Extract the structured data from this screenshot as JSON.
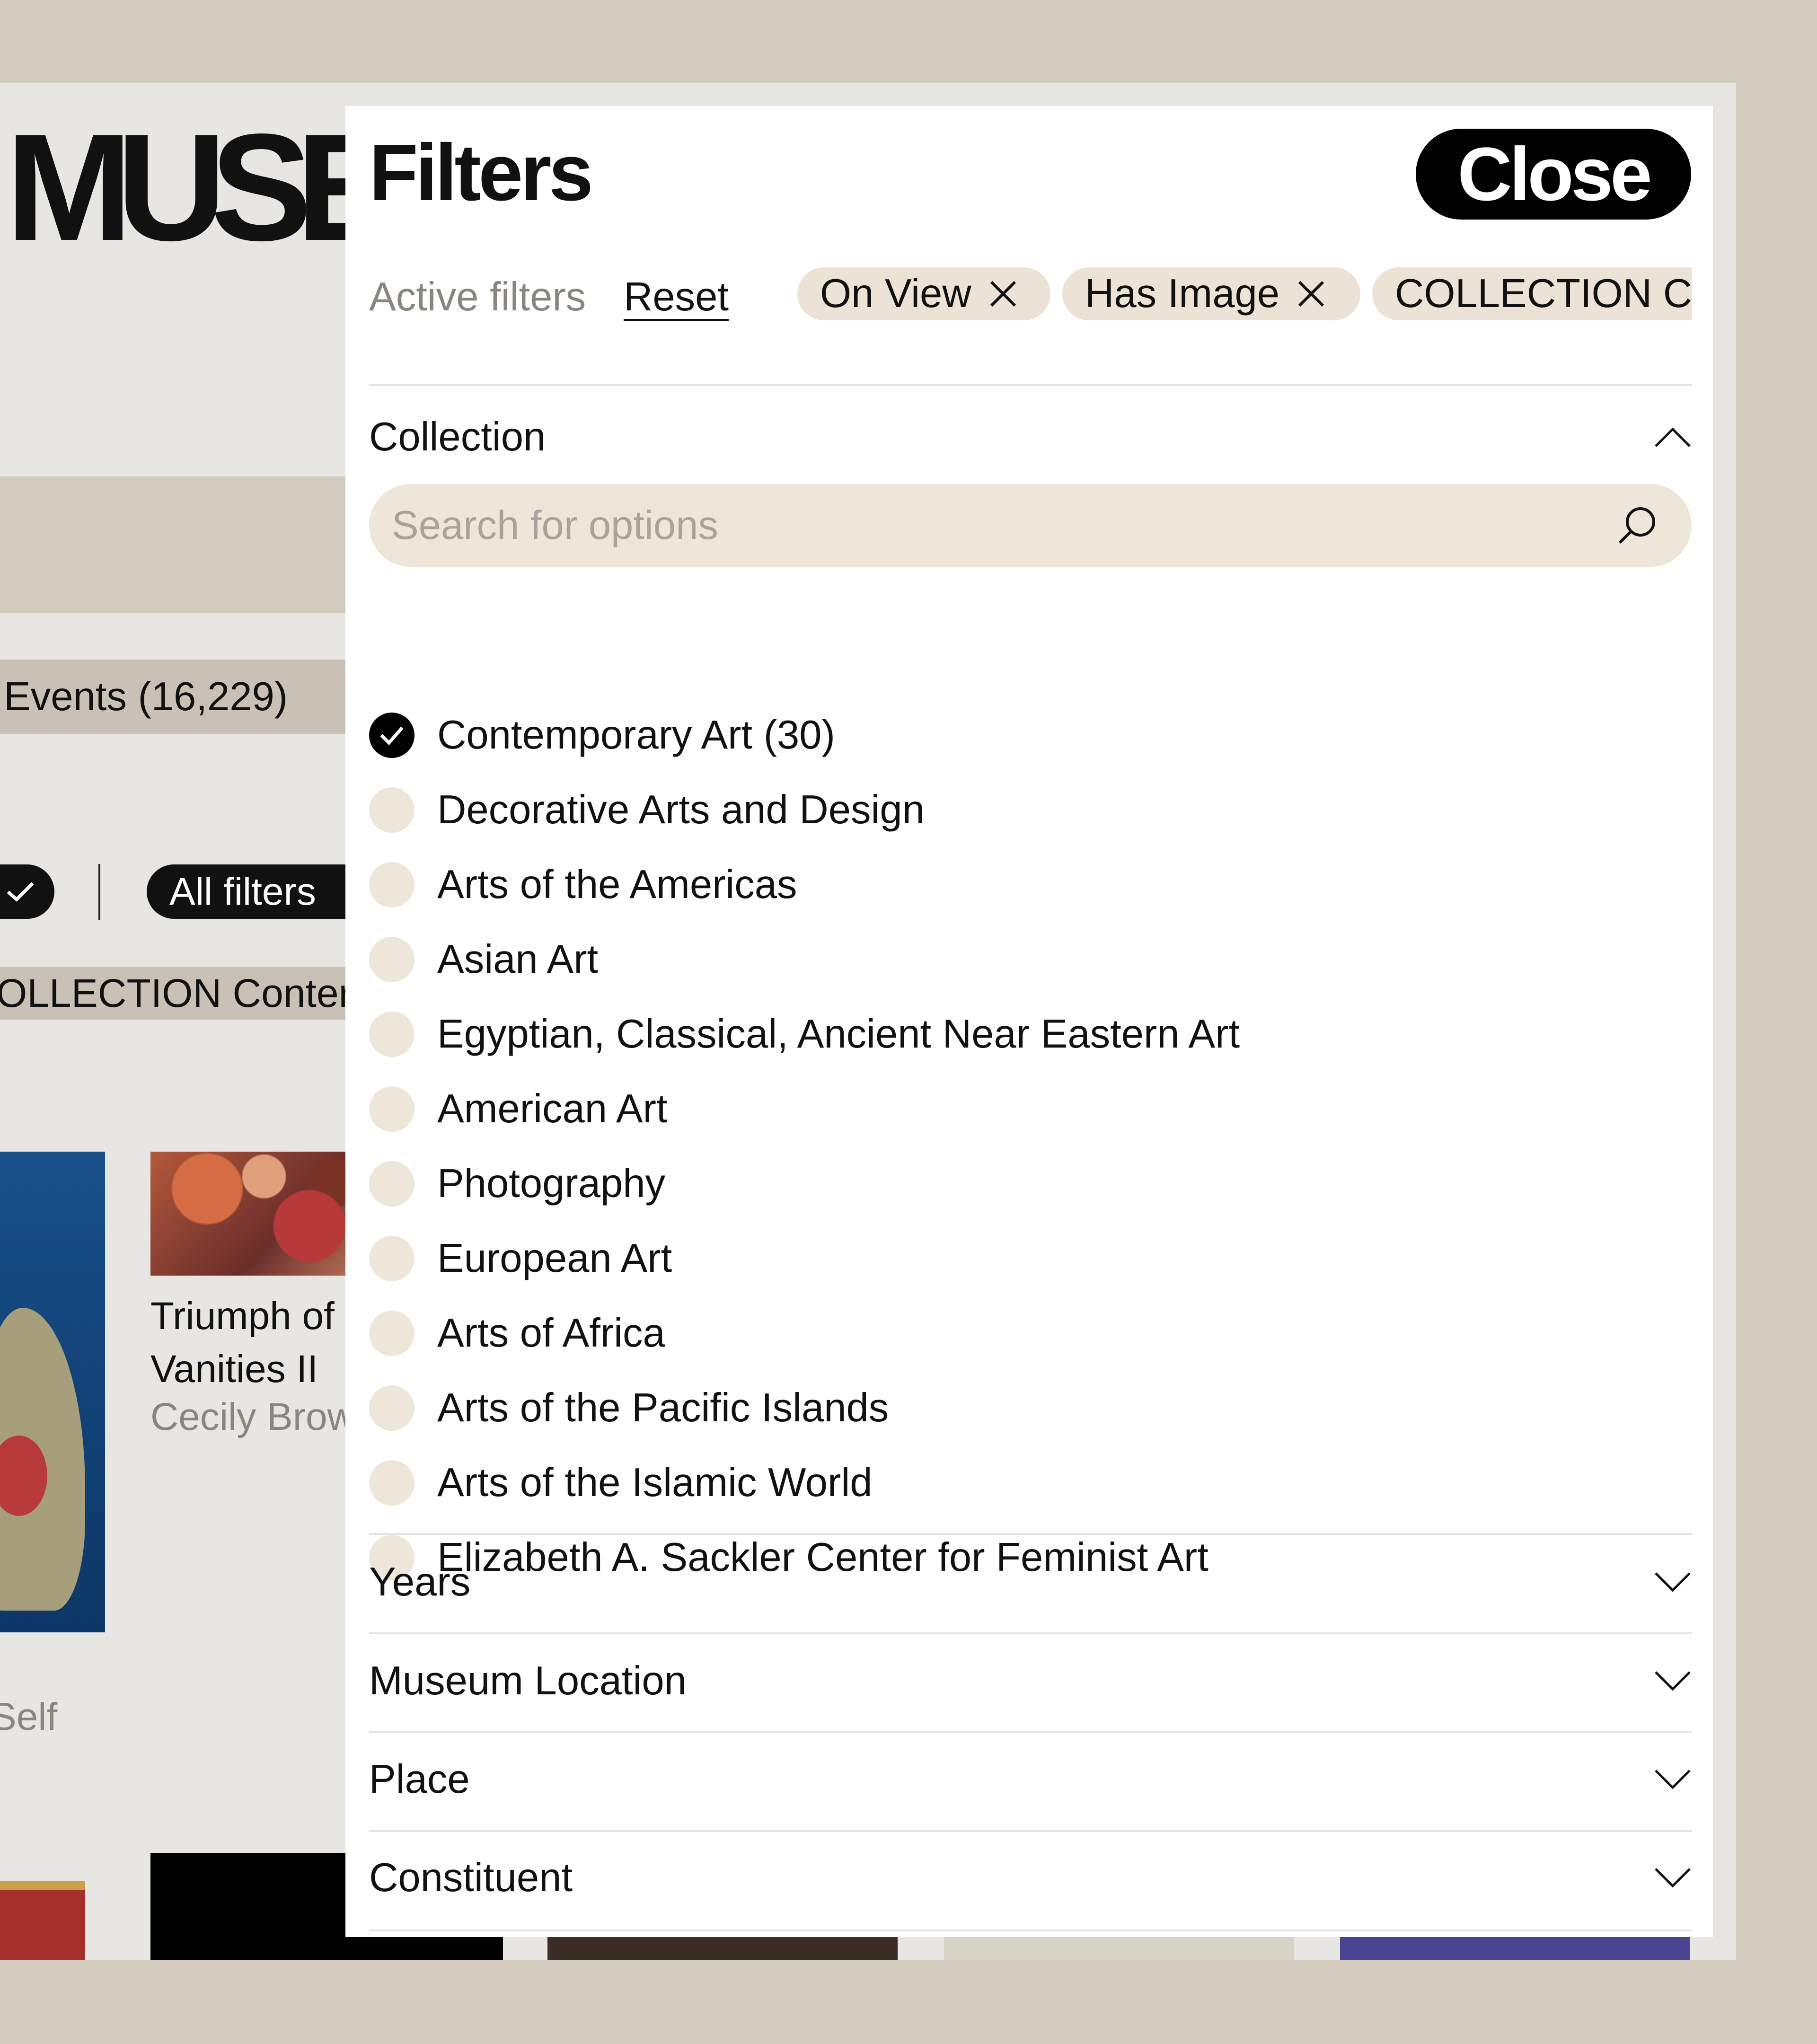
{
  "background": {
    "logo": "MUSEU",
    "events_tab": "Events (16,229)",
    "all_filters": "All filters",
    "collection_tag": "OLLECTION Conter",
    "artwork": {
      "title_line1": "Triumph of",
      "title_line2": "Vanities II",
      "artist": "Cecily Brow"
    },
    "self_text": "Self"
  },
  "panel": {
    "title": "Filters",
    "close_label": "Close",
    "active_filters_label": "Active filters",
    "reset_label": "Reset",
    "active_chips": [
      "On View",
      "Has Image",
      "COLLECTION Co"
    ]
  },
  "collection": {
    "label": "Collection",
    "search_placeholder": "Search for options",
    "options": [
      {
        "label": "Contemporary Art (30)",
        "checked": true
      },
      {
        "label": "Decorative Arts and Design",
        "checked": false
      },
      {
        "label": "Arts of the Americas",
        "checked": false
      },
      {
        "label": "Asian Art",
        "checked": false
      },
      {
        "label": "Egyptian, Classical, Ancient Near Eastern Art",
        "checked": false
      },
      {
        "label": "American Art",
        "checked": false
      },
      {
        "label": "Photography",
        "checked": false
      },
      {
        "label": "European Art",
        "checked": false
      },
      {
        "label": "Arts of Africa",
        "checked": false
      },
      {
        "label": "Arts of the Pacific Islands",
        "checked": false
      },
      {
        "label": "Arts of the Islamic World",
        "checked": false
      },
      {
        "label": "Elizabeth A. Sackler Center for Feminist Art",
        "checked": false
      }
    ]
  },
  "sections": [
    "Years",
    "Museum Location",
    "Place",
    "Constituent"
  ],
  "colors": {
    "backdrop": "#d3cabe",
    "chip_bg": "#ece2d5",
    "radio_bg": "#efe6da",
    "accent": "#000000"
  }
}
